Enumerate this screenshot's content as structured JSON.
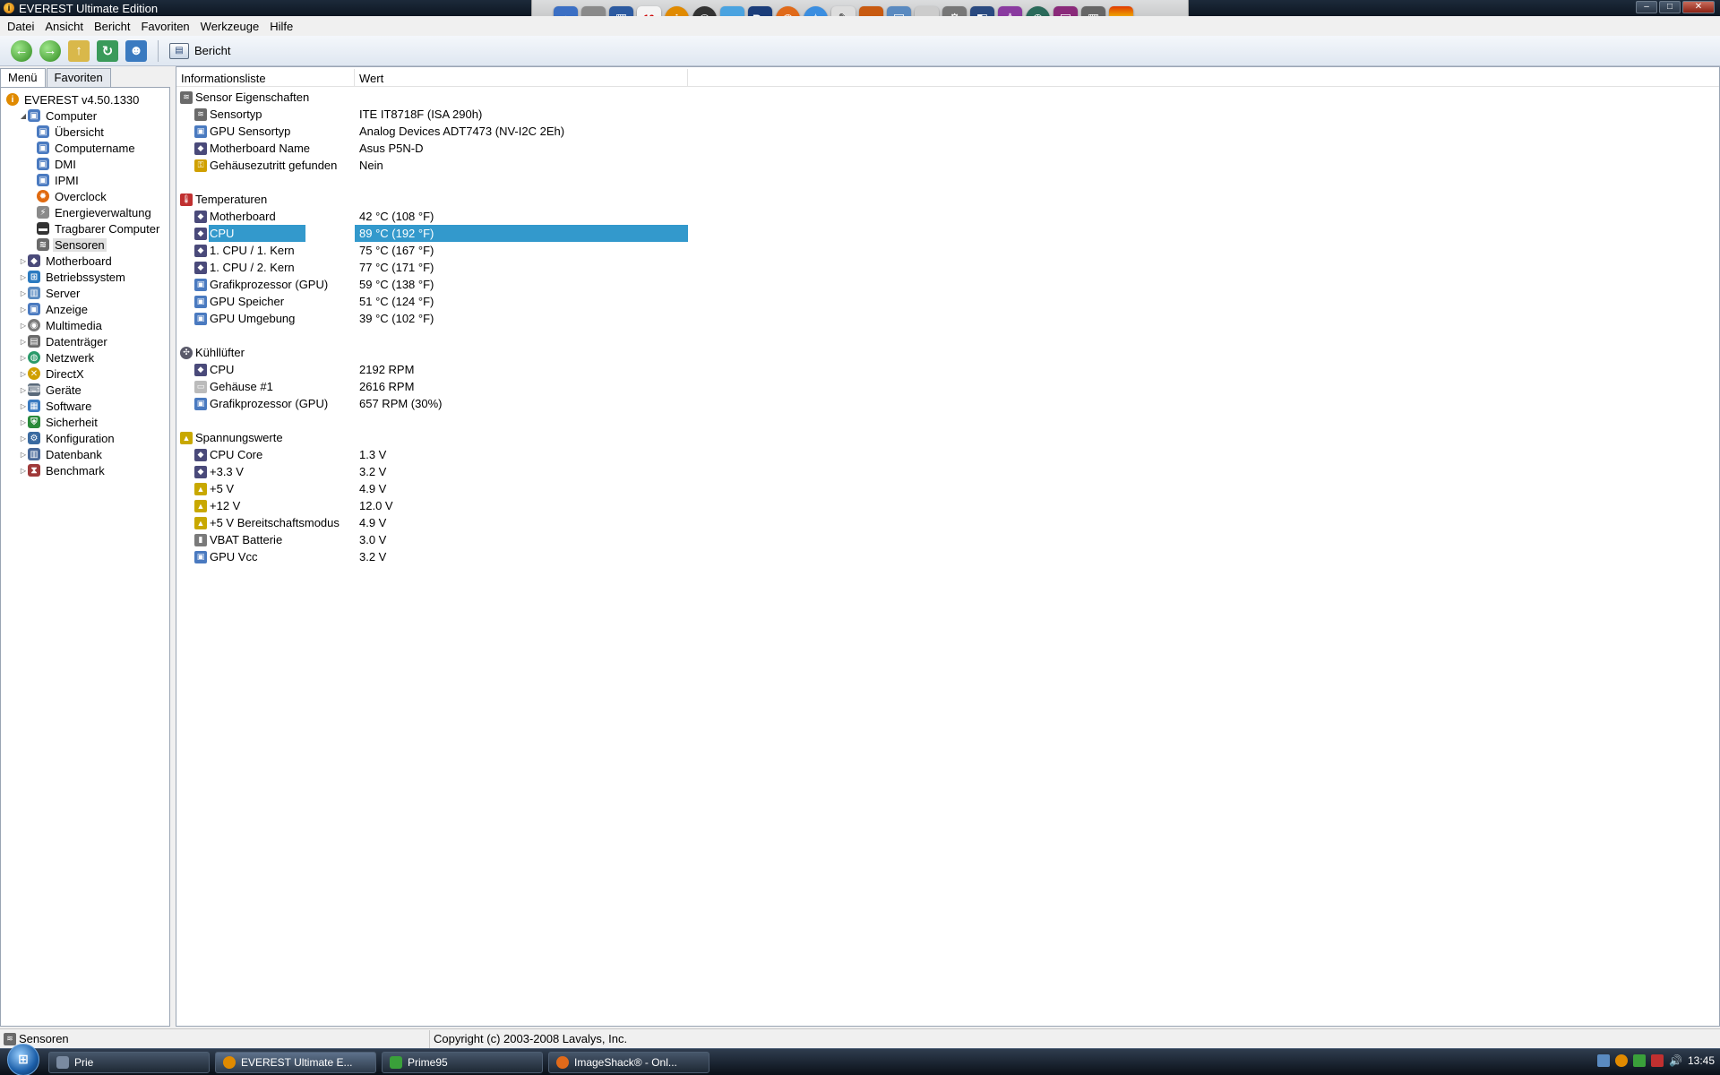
{
  "window": {
    "title": "EVEREST Ultimate Edition",
    "controls": {
      "minimize": "–",
      "maximize": "□",
      "close": "✕"
    }
  },
  "menu": [
    "Datei",
    "Ansicht",
    "Bericht",
    "Favoriten",
    "Werkzeuge",
    "Hilfe"
  ],
  "toolbar": {
    "back": "back-arrow",
    "forward": "forward-arrow",
    "up": "up-arrow",
    "refresh": "refresh",
    "users": "users",
    "report_label": "Bericht"
  },
  "dock": {
    "icons": [
      "finder",
      "drive",
      "window",
      "calendar-10",
      "info",
      "film-reel",
      "itunes",
      "photoshop",
      "firefox",
      "safari",
      "pen",
      "triangle-app",
      "monitor",
      "notes",
      "gear",
      "dashboard",
      "figure",
      "clock",
      "screen",
      "trash",
      "equalizer"
    ],
    "calendar_text": "10",
    "ps_text": "Ps"
  },
  "left_tabs": [
    "Menü",
    "Favoriten"
  ],
  "tree": {
    "root": "EVEREST v4.50.1330",
    "computer": "Computer",
    "computer_children": [
      "Übersicht",
      "Computername",
      "DMI",
      "IPMI",
      "Overclock",
      "Energieverwaltung",
      "Tragbarer Computer",
      "Sensoren"
    ],
    "top_items": [
      "Motherboard",
      "Betriebssystem",
      "Server",
      "Anzeige",
      "Multimedia",
      "Datenträger",
      "Netzwerk",
      "DirectX",
      "Geräte",
      "Software",
      "Sicherheit",
      "Konfiguration",
      "Datenbank",
      "Benchmark"
    ]
  },
  "columns": {
    "info": "Informationsliste",
    "value": "Wert"
  },
  "sections": {
    "sensor": {
      "title": "Sensor Eigenschaften",
      "rows": [
        {
          "label": "Sensortyp",
          "value": "ITE IT8718F  (ISA 290h)"
        },
        {
          "label": "GPU Sensortyp",
          "value": "Analog Devices ADT7473  (NV-I2C 2Eh)"
        },
        {
          "label": "Motherboard Name",
          "value": "Asus P5N-D"
        },
        {
          "label": "Gehäusezutritt gefunden",
          "value": "Nein"
        }
      ]
    },
    "temps": {
      "title": "Temperaturen",
      "rows": [
        {
          "label": "Motherboard",
          "value": "42 °C  (108 °F)"
        },
        {
          "label": "CPU",
          "value": "89 °C  (192 °F)"
        },
        {
          "label": "1. CPU / 1. Kern",
          "value": "75 °C  (167 °F)"
        },
        {
          "label": "1. CPU / 2. Kern",
          "value": "77 °C  (171 °F)"
        },
        {
          "label": "Grafikprozessor (GPU)",
          "value": "59 °C  (138 °F)"
        },
        {
          "label": "GPU Speicher",
          "value": "51 °C  (124 °F)"
        },
        {
          "label": "GPU Umgebung",
          "value": "39 °C  (102 °F)"
        }
      ]
    },
    "fans": {
      "title": "Kühllüfter",
      "rows": [
        {
          "label": "CPU",
          "value": "2192 RPM"
        },
        {
          "label": "Gehäuse #1",
          "value": "2616 RPM"
        },
        {
          "label": "Grafikprozessor (GPU)",
          "value": "657 RPM  (30%)"
        }
      ]
    },
    "volts": {
      "title": "Spannungswerte",
      "rows": [
        {
          "label": "CPU Core",
          "value": "1.3 V"
        },
        {
          "label": "+3.3 V",
          "value": "3.2 V"
        },
        {
          "label": "+5 V",
          "value": "4.9 V"
        },
        {
          "label": "+12 V",
          "value": "12.0 V"
        },
        {
          "label": "+5 V Bereitschaftsmodus",
          "value": "4.9 V"
        },
        {
          "label": "VBAT Batterie",
          "value": "3.0 V"
        },
        {
          "label": "GPU Vcc",
          "value": "3.2 V"
        }
      ]
    }
  },
  "status": {
    "left": "Sensoren",
    "right": "Copyright (c) 2003-2008 Lavalys, Inc."
  },
  "taskbar": {
    "buttons": [
      "Prie",
      "EVEREST Ultimate E...",
      "Prime95",
      "ImageShack® - Onl..."
    ],
    "clock": "13:45"
  },
  "colors": {
    "selection": "#3399cc",
    "titlebar": "#1c2a3a",
    "accent_green": "#2e8a1e"
  }
}
